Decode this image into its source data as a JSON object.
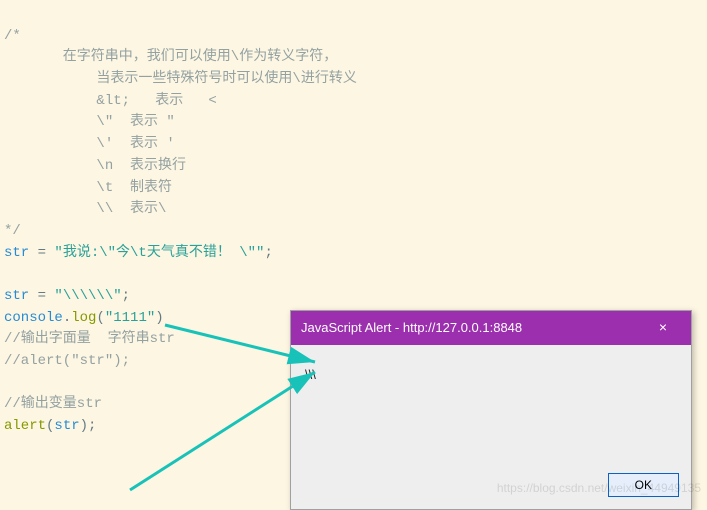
{
  "code": {
    "c_open": "/*",
    "c_l1": "       在字符串中，我们可以使用\\作为转义字符，",
    "c_l2": "           当表示一些特殊符号时可以使用\\进行转义",
    "c_l3": "           &lt;   表示   <",
    "c_l4": "           \\\"  表示 \"",
    "c_l5": "           \\'  表示 '",
    "c_l6": "           \\n  表示换行",
    "c_l7": "           \\t  制表符",
    "c_l8": "           \\\\  表示\\",
    "c_close": "*/",
    "str1_lhs": "str ",
    "str1_eq": "= ",
    "str1_val": "\"我说:\\\"今\\t天气真不错！ \\\"\"",
    "semi": ";",
    "str2_lhs": "str ",
    "str2_eq": "= ",
    "str2_val": "\"\\\\\\\\\\\\\"",
    "console": "console",
    "dot": ".",
    "log": "log",
    "lp": "(",
    "rp": ")",
    "log_arg": "\"1111\"",
    "c_out1": "//输出字面量  字符串str",
    "c_out2": "//alert(\"str\");",
    "c_out3": "//输出变量str",
    "alert_fn": "alert",
    "alert_arg": "str"
  },
  "alert": {
    "title": "JavaScript Alert - http://127.0.0.1:8848",
    "close": "×",
    "body": "\\\\\\",
    "ok": "OK"
  },
  "watermark": "https://blog.csdn.net/weixin_44949135"
}
